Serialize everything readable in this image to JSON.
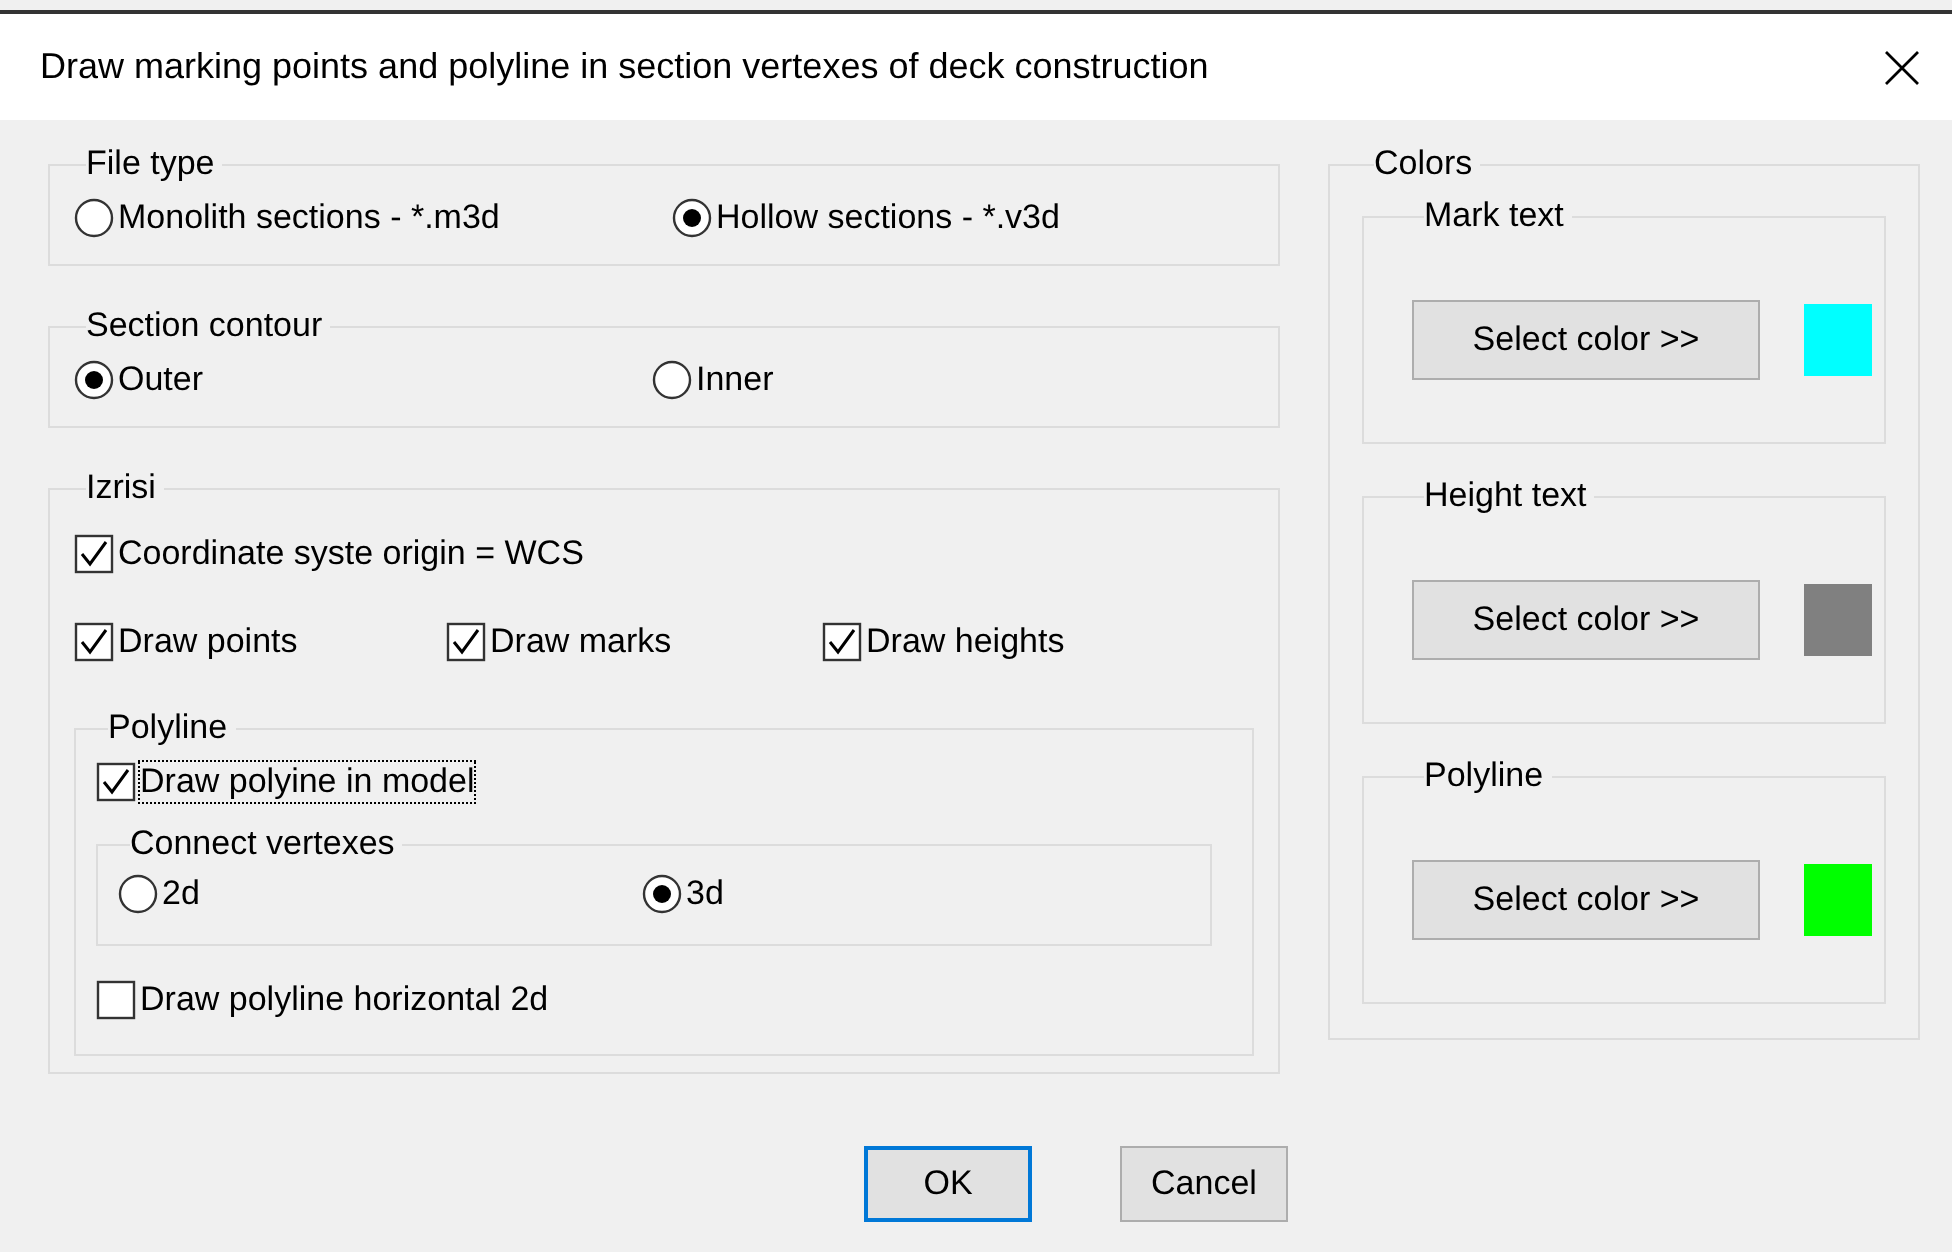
{
  "window": {
    "title": "Draw marking points and polyline in section vertexes of deck construction"
  },
  "file_type": {
    "label": "File type",
    "options": [
      {
        "label": "Monolith sections - *.m3d",
        "selected": false
      },
      {
        "label": "Hollow sections - *.v3d",
        "selected": true
      }
    ]
  },
  "section_contour": {
    "label": "Section contour",
    "options": [
      {
        "label": "Outer",
        "selected": true
      },
      {
        "label": "Inner",
        "selected": false
      }
    ]
  },
  "izrisi": {
    "label": "Izrisi",
    "origin": {
      "label": "Coordinate syste origin = WCS",
      "checked": true
    },
    "draw_options": [
      {
        "label": "Draw points",
        "checked": true
      },
      {
        "label": "Draw marks",
        "checked": true
      },
      {
        "label": "Draw heights",
        "checked": true
      }
    ],
    "polyline": {
      "label": "Polyline",
      "draw_in_model": {
        "label": "Draw polyine in model",
        "checked": true,
        "focused": true
      },
      "connect_vertexes": {
        "label": "Connect vertexes",
        "options": [
          {
            "label": "2d",
            "selected": false
          },
          {
            "label": "3d",
            "selected": true
          }
        ]
      },
      "horizontal_2d": {
        "label": "Draw polyline horizontal 2d",
        "checked": false
      }
    }
  },
  "colors": {
    "label": "Colors",
    "groups": [
      {
        "label": "Mark text",
        "button": "Select color >>",
        "color": "#00ffff"
      },
      {
        "label": "Height text",
        "button": "Select color >>",
        "color": "#808080"
      },
      {
        "label": "Polyline",
        "button": "Select color >>",
        "color": "#00ff00"
      }
    ]
  },
  "buttons": [
    {
      "label": "OK",
      "default": true
    },
    {
      "label": "Cancel",
      "default": false
    }
  ]
}
